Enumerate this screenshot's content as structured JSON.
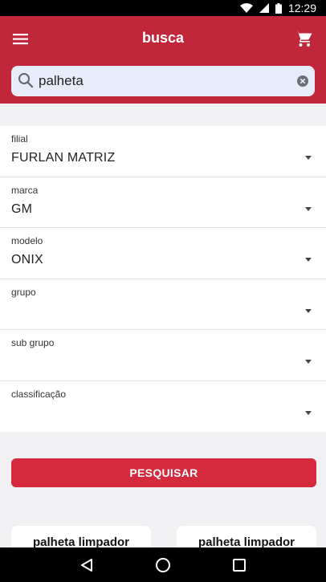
{
  "status_bar": {
    "time": "12:29"
  },
  "header": {
    "title": "busca"
  },
  "search": {
    "value": "palheta"
  },
  "form": {
    "fields": [
      {
        "label": "filial",
        "value": "FURLAN MATRIZ"
      },
      {
        "label": "marca",
        "value": "GM"
      },
      {
        "label": "modelo",
        "value": "ONIX"
      },
      {
        "label": "grupo",
        "value": ""
      },
      {
        "label": "sub grupo",
        "value": ""
      },
      {
        "label": "classificação",
        "value": ""
      }
    ]
  },
  "actions": {
    "search_label": "PESQUISAR"
  },
  "results": [
    {
      "title": "palheta limpador"
    },
    {
      "title": "palheta limpador"
    }
  ],
  "icons": [
    "wifi-icon",
    "signal-icon",
    "battery-icon",
    "menu-icon",
    "cart-icon",
    "search-icon",
    "clear-icon",
    "back-icon",
    "home-icon",
    "recents-icon"
  ],
  "colors": {
    "brand": "#c0273a",
    "button": "#d52a3e",
    "search_bg": "#e6edf9",
    "page_bg": "#f1f1f3"
  }
}
